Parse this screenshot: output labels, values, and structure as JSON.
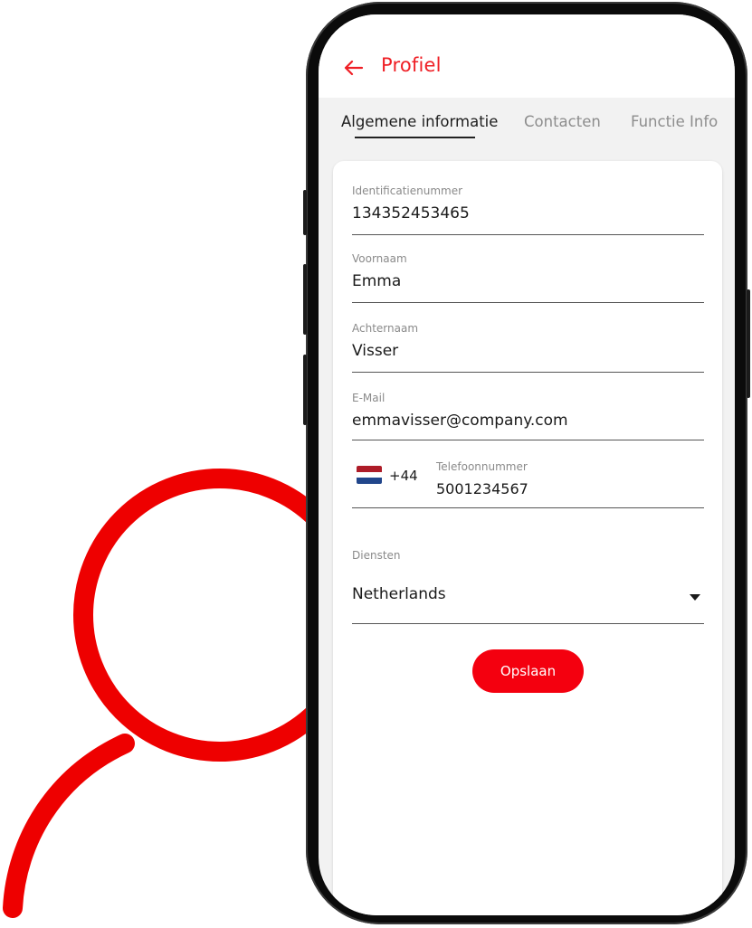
{
  "app": {
    "title": "Profiel",
    "accent_color": "#ef1f25",
    "back_icon": "arrow-left-icon"
  },
  "tabs": [
    {
      "label": "Algemene informatie",
      "active": true
    },
    {
      "label": "Contacten",
      "active": false
    },
    {
      "label": "Functie Info",
      "active": false
    }
  ],
  "form": {
    "id_number": {
      "label": "Identificatienummer",
      "value": "134352453465"
    },
    "first_name": {
      "label": "Voornaam",
      "value": "Emma"
    },
    "last_name": {
      "label": "Achternaam",
      "value": "Visser"
    },
    "email": {
      "label": "E-Mail",
      "value": "emmavisser@company.com"
    },
    "phone": {
      "country_flag": "netherlands-flag-icon",
      "dial_code": "+44",
      "label": "Telefoonnummer",
      "value": "5001234567"
    },
    "services": {
      "label": "Diensten",
      "selected": "Netherlands"
    }
  },
  "save_button": {
    "label": "Opslaan",
    "color": "#f4000f"
  }
}
